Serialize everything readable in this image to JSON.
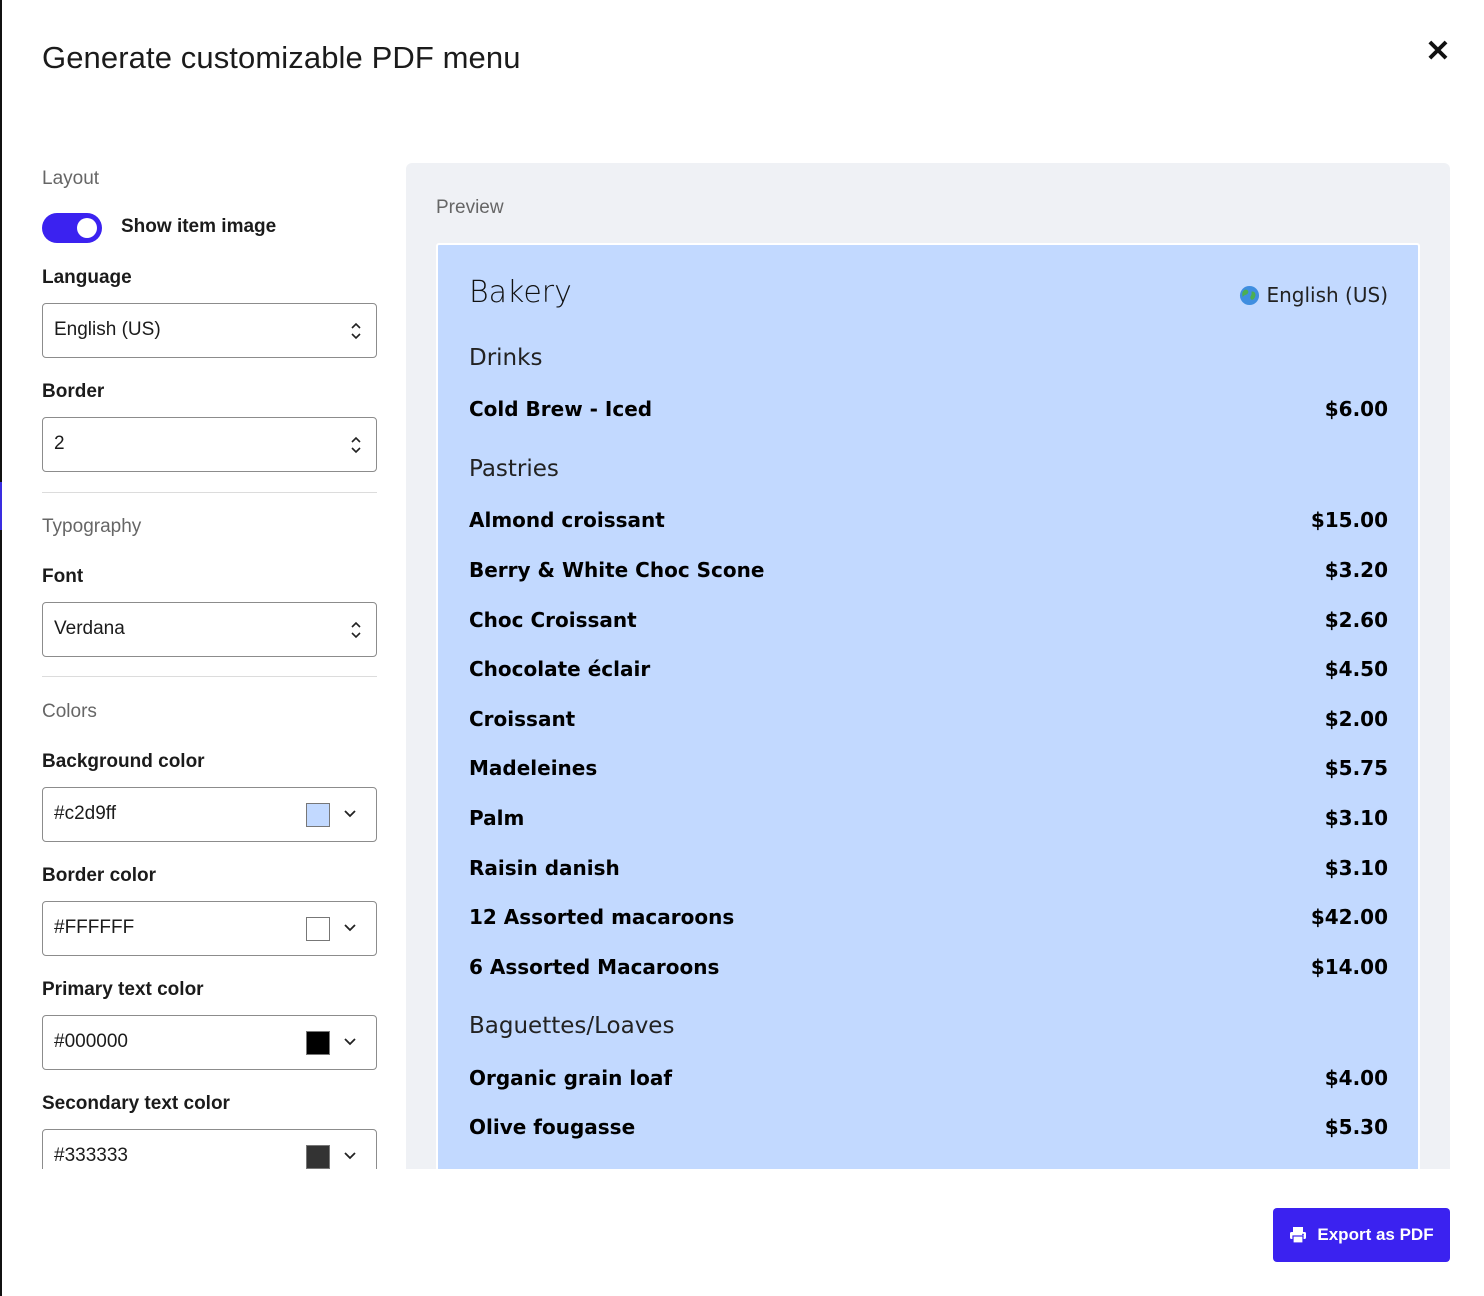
{
  "modal": {
    "title": "Generate customizable PDF menu"
  },
  "settings": {
    "layout_heading": "Layout",
    "show_image_label": "Show item image",
    "show_image_on": true,
    "language_label": "Language",
    "language_value": "English (US)",
    "border_label": "Border",
    "border_value": "2",
    "typography_heading": "Typography",
    "font_label": "Font",
    "font_value": "Verdana",
    "colors_heading": "Colors",
    "background_color_label": "Background color",
    "background_color_value": "#c2d9ff",
    "border_color_label": "Border color",
    "border_color_value": "#FFFFFF",
    "primary_text_label": "Primary text color",
    "primary_text_value": "#000000",
    "secondary_text_label": "Secondary text color",
    "secondary_text_value": "#333333"
  },
  "preview": {
    "label": "Preview",
    "menu_title": "Bakery",
    "language": "English (US)",
    "categories": [
      {
        "name": "Drinks",
        "items": [
          {
            "name": "Cold Brew - Iced",
            "price": "$6.00"
          }
        ]
      },
      {
        "name": "Pastries",
        "items": [
          {
            "name": "Almond croissant",
            "price": "$15.00"
          },
          {
            "name": "Berry & White Choc Scone",
            "price": "$3.20"
          },
          {
            "name": "Choc Croissant",
            "price": "$2.60"
          },
          {
            "name": "Chocolate éclair",
            "price": "$4.50"
          },
          {
            "name": "Croissant",
            "price": "$2.00"
          },
          {
            "name": "Madeleines",
            "price": "$5.75"
          },
          {
            "name": "Palm",
            "price": "$3.10"
          },
          {
            "name": "Raisin danish",
            "price": "$3.10"
          },
          {
            "name": "12 Assorted macaroons",
            "price": "$42.00"
          },
          {
            "name": "6 Assorted Macaroons",
            "price": "$14.00"
          }
        ]
      },
      {
        "name": "Baguettes/Loaves",
        "items": [
          {
            "name": "Organic grain loaf",
            "price": "$4.00"
          },
          {
            "name": "Olive fougasse",
            "price": "$5.30"
          }
        ]
      }
    ]
  },
  "actions": {
    "export_label": "Export as PDF"
  },
  "colors": {
    "accent": "#3b22f0",
    "preview_bg": "#c2d9ff",
    "panel_bg": "#eff1f5"
  }
}
